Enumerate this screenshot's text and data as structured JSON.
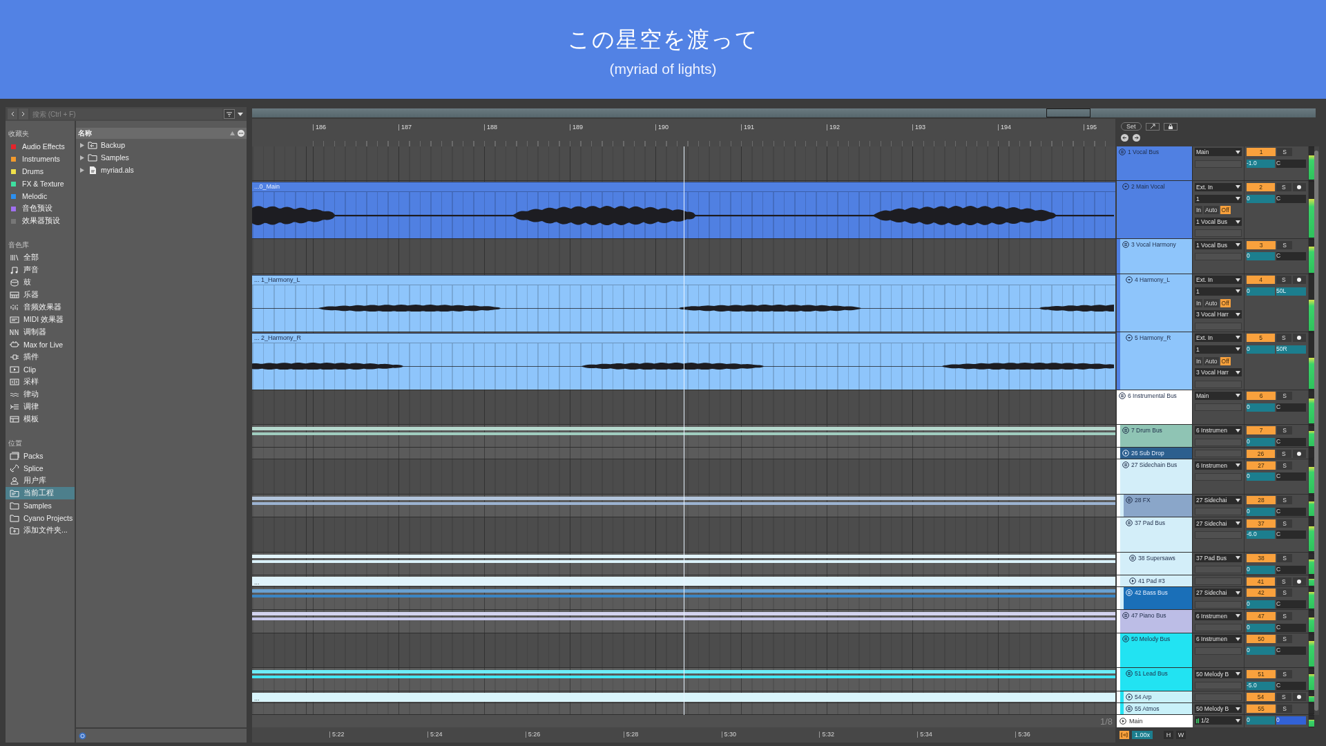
{
  "banner": {
    "title": "この星空を渡って",
    "subtitle": "(myriad of lights)"
  },
  "browser": {
    "search": {
      "placeholder": "搜索 (Ctrl + F)"
    },
    "sections": [
      {
        "title": "收藏夹",
        "kind": "tags",
        "items": [
          {
            "label": "Audio Effects",
            "color": "#e5242b",
            "selected": false
          },
          {
            "label": "Instruments",
            "color": "#f39a2c",
            "selected": false
          },
          {
            "label": "Drums",
            "color": "#efe04a",
            "selected": false
          },
          {
            "label": "FX & Texture",
            "color": "#3ee0a0",
            "selected": false
          },
          {
            "label": "Melodic",
            "color": "#2b8ff0",
            "selected": false
          },
          {
            "label": "音色预设",
            "color": "#a070f0",
            "selected": false
          },
          {
            "label": "效果器预设",
            "color": "#777777",
            "selected": false
          }
        ]
      },
      {
        "title": "音色库",
        "kind": "library",
        "items": [
          {
            "label": "全部",
            "selected": false
          },
          {
            "label": "声音",
            "selected": false
          },
          {
            "label": "鼓",
            "selected": false
          },
          {
            "label": "乐器",
            "selected": false
          },
          {
            "label": "音频效果器",
            "selected": false
          },
          {
            "label": "MIDI 效果器",
            "selected": false
          },
          {
            "label": "调制器",
            "selected": false
          },
          {
            "label": "Max for Live",
            "selected": false
          },
          {
            "label": "插件",
            "selected": false
          },
          {
            "label": "Clip",
            "selected": false
          },
          {
            "label": "采样",
            "selected": false
          },
          {
            "label": "律动",
            "selected": false
          },
          {
            "label": "调律",
            "selected": false
          },
          {
            "label": "模板",
            "selected": false
          }
        ]
      },
      {
        "title": "位置",
        "kind": "places",
        "items": [
          {
            "label": "Packs",
            "selected": false
          },
          {
            "label": "Splice",
            "selected": false
          },
          {
            "label": "用户库",
            "selected": false
          },
          {
            "label": "当前工程",
            "selected": true
          },
          {
            "label": "Samples",
            "selected": false
          },
          {
            "label": "Cyano Projects",
            "selected": false
          },
          {
            "label": "添加文件夹...",
            "selected": false
          }
        ]
      }
    ],
    "files": {
      "header": "名称",
      "items": [
        {
          "label": "Backup",
          "kind": "backup",
          "expanded": false
        },
        {
          "label": "Samples",
          "kind": "folder",
          "expanded": false
        },
        {
          "label": "myriad.als",
          "kind": "document",
          "expanded": false
        }
      ]
    }
  },
  "arrangement": {
    "bars": [
      "186",
      "187",
      "188",
      "189",
      "190",
      "191",
      "192",
      "193",
      "194",
      "195"
    ],
    "times": [
      "5:22",
      "5:24",
      "5:26",
      "5:28",
      "5:30",
      "5:32",
      "5:34",
      "5:36"
    ],
    "grid": "1/8"
  },
  "mixer_top": {
    "set_button": "Set"
  },
  "tracks": [
    {
      "name": "1 Vocal Bus",
      "number": "1",
      "solo": "S",
      "kind": "group",
      "color": "#5080e2",
      "output": "Main",
      "volume": "-1.0",
      "pan": "C",
      "pan_active": false,
      "level": 0.75,
      "children": [
        {
          "name": "2 Main Vocal",
          "number": "2",
          "solo": "S",
          "kind": "audio",
          "color": "#5080e2",
          "input": "Ext. In",
          "input_channel": "1",
          "monitor": [
            {
              "label": "In",
              "selected": false
            },
            {
              "label": "Auto",
              "selected": false
            },
            {
              "label": "Off",
              "selected": true
            }
          ],
          "output": "1 Vocal Bus",
          "volume": "0",
          "pan": "C",
          "pan_active": false,
          "level": 0.7,
          "clip": {
            "label": "...0_Main"
          }
        },
        {
          "name": "3 Vocal Harmony",
          "number": "3",
          "solo": "S",
          "kind": "group",
          "color": "#8ec5fb",
          "output": "1 Vocal Bus",
          "volume": "0",
          "pan": "C",
          "pan_active": false,
          "level": 0.8,
          "children": [
            {
              "name": "4 Harmony_L",
              "number": "4",
              "solo": "S",
              "kind": "audio",
              "color": "#8ec5fb",
              "input": "Ext. In",
              "input_channel": "1",
              "monitor": [
                {
                  "label": "In",
                  "selected": false
                },
                {
                  "label": "Auto",
                  "selected": false
                },
                {
                  "label": "Off",
                  "selected": true
                }
              ],
              "output": "3 Vocal Harr",
              "volume": "0",
              "pan": "50L",
              "pan_active": true,
              "level": 0.55,
              "clip": {
                "label": "... 1_Harmony_L"
              }
            },
            {
              "name": "5 Harmony_R",
              "number": "5",
              "solo": "S",
              "kind": "audio",
              "color": "#8ec5fb",
              "input": "Ext. In",
              "input_channel": "1",
              "monitor": [
                {
                  "label": "In",
                  "selected": false
                },
                {
                  "label": "Auto",
                  "selected": false
                },
                {
                  "label": "Off",
                  "selected": true
                }
              ],
              "output": "3 Vocal Harr",
              "volume": "0",
              "pan": "50R",
              "pan_active": true,
              "level": 0.55,
              "clip": {
                "label": "... 2_Harmony_R"
              }
            }
          ]
        }
      ]
    },
    {
      "name": "6 Instrumental Bus",
      "number": "6",
      "solo": "S",
      "kind": "group",
      "color": "#ffffff",
      "output": "Main",
      "volume": "0",
      "pan": "C",
      "pan_active": false,
      "level": 0.75,
      "children": [
        {
          "name": "7 Drum Bus",
          "number": "7",
          "solo": "S",
          "kind": "group",
          "color": "#8fc4b4",
          "output": "6 Instrumen",
          "volume": "0",
          "pan": "C",
          "pan_active": false,
          "level": 0.75
        },
        {
          "name": "26 Sub Drop",
          "number": "26",
          "solo": "S",
          "kind": "midi",
          "color": "#2c5f8e"
        },
        {
          "name": "27 Sidechain Bus",
          "number": "27",
          "solo": "S",
          "kind": "group",
          "color": "#d3eef9",
          "output": "6 Instrumen",
          "volume": "0",
          "pan": "C",
          "pan_active": false,
          "level": 0.8,
          "children": [
            {
              "name": "28 FX",
              "number": "28",
              "solo": "S",
              "kind": "group",
              "color": "#8aa6c9",
              "output": "27 Sidechai",
              "volume": "0",
              "pan": "C",
              "pan_active": false,
              "level": 0.7
            },
            {
              "name": "37 Pad Bus",
              "number": "37",
              "solo": "S",
              "kind": "group",
              "color": "#d3eef9",
              "output": "27 Sidechai",
              "volume": "-6.0",
              "pan": "C",
              "pan_active": false,
              "level": 0.75,
              "children": [
                {
                  "name": "38 Supersaws",
                  "number": "38",
                  "solo": "S",
                  "kind": "group",
                  "color": "#d3eef9",
                  "output": "37 Pad Bus",
                  "volume": "0",
                  "pan": "C",
                  "pan_active": false,
                  "level": 0.7
                },
                {
                  "name": "41 Pad #3",
                  "number": "41",
                  "solo": "S",
                  "kind": "midi",
                  "color": "#d3eef9",
                  "level": 0.7,
                  "clip": {
                    "label": "..."
                  }
                }
              ]
            },
            {
              "name": "42 Bass Bus",
              "number": "42",
              "solo": "S",
              "kind": "group",
              "color": "#1a6fb8",
              "output": "27 Sidechai",
              "volume": "0",
              "pan": "C",
              "pan_active": false,
              "level": 0.8
            }
          ]
        },
        {
          "name": "47 Piano Bus",
          "number": "47",
          "solo": "S",
          "kind": "group",
          "color": "#bcbde6",
          "output": "6 Instrumen",
          "volume": "0",
          "pan": "C",
          "pan_active": false,
          "level": 0.7
        },
        {
          "name": "50 Melody Bus",
          "number": "50",
          "solo": "S",
          "kind": "group",
          "color": "#22e3f2",
          "output": "6 Instrumen",
          "volume": "0",
          "pan": "C",
          "pan_active": false,
          "level": 0.8,
          "children": [
            {
              "name": "51 Lead Bus",
              "number": "51",
              "solo": "S",
              "kind": "group",
              "color": "#22e3f2",
              "output": "50 Melody B",
              "volume": "-5.0",
              "pan": "C",
              "pan_active": false,
              "level": 0.75
            },
            {
              "name": "54 Arp",
              "number": "54",
              "solo": "S",
              "kind": "midi",
              "color": "#c9f1f9",
              "level": 0.6,
              "clip": {
                "label": "..."
              }
            },
            {
              "name": "55 Atmos",
              "number": "55",
              "solo": "S",
              "kind": "group",
              "color": "#c9f1f9",
              "output": "50 Melody B"
            }
          ]
        }
      ]
    }
  ],
  "main_track": {
    "name": "Main",
    "output": "1/2",
    "volume": "0",
    "cue": "0",
    "level": 0.6
  },
  "footer": {
    "scale": "1.00x",
    "buttons": [
      "H",
      "W"
    ]
  }
}
